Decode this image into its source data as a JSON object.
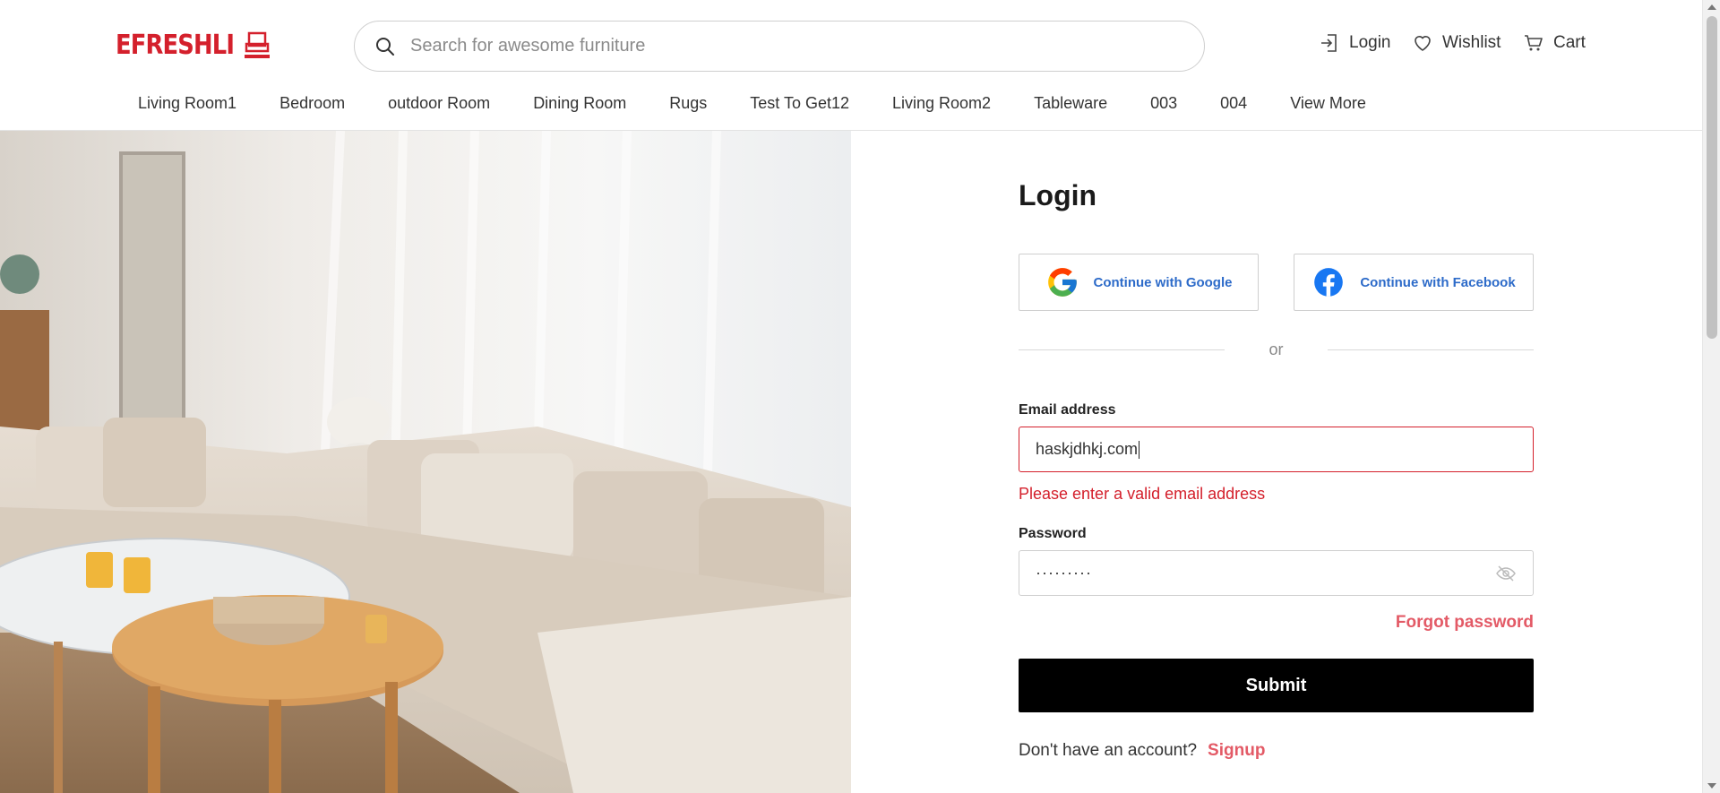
{
  "brand": {
    "name": "EFRESHLI",
    "color": "#d4202c"
  },
  "search": {
    "placeholder": "Search for awesome furniture"
  },
  "header_actions": {
    "login": "Login",
    "wishlist": "Wishlist",
    "cart": "Cart"
  },
  "nav": {
    "items": [
      "Living Room1",
      "Bedroom",
      "outdoor Room",
      "Dining Room",
      "Rugs",
      "Test To Get12",
      "Living Room2",
      "Tableware",
      "003",
      "004",
      "View More"
    ]
  },
  "login_form": {
    "title": "Login",
    "google_label": "Continue with Google",
    "facebook_label": "Continue with Facebook",
    "divider_text": "or",
    "email_label": "Email address",
    "email_value": "haskjdhkj.com",
    "email_error": "Please enter a valid email address",
    "password_label": "Password",
    "password_value": "·········",
    "forgot_label": "Forgot password",
    "submit_label": "Submit",
    "signup_prompt": "Don't have an account?",
    "signup_link": "Signup"
  },
  "colors": {
    "accent_red": "#d4202c",
    "link_pink": "#e35a66",
    "social_blue": "#2d6bc9",
    "submit_bg": "#000000"
  }
}
